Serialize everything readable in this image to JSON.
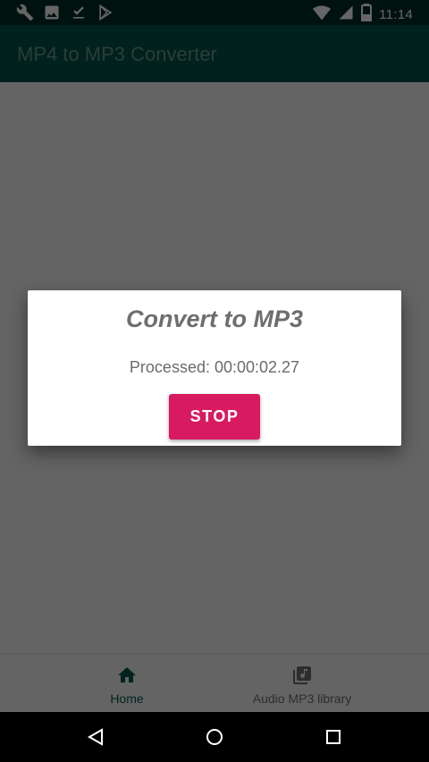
{
  "status_bar": {
    "time": "11:14",
    "left_icons": [
      "wrench-icon",
      "image-icon",
      "download-done-icon",
      "play-store-icon"
    ],
    "right_icons": [
      "wifi-icon",
      "signal-icon",
      "battery-icon"
    ]
  },
  "app_bar": {
    "title": "MP4 to MP3 Converter"
  },
  "dialog": {
    "title": "Convert to MP3",
    "message": "Processed: 00:00:02.27",
    "stop_label": "STOP",
    "accent_color": "#d81b60"
  },
  "bottom_nav": {
    "items": [
      {
        "label": "Home",
        "icon": "home-icon",
        "active": true
      },
      {
        "label": "Audio MP3 library",
        "icon": "music-library-icon",
        "active": false
      }
    ],
    "active_color": "#00574a"
  },
  "system_nav": {
    "buttons": [
      "back-icon",
      "home-circle-icon",
      "recents-icon"
    ]
  },
  "colors": {
    "primary": "#005446",
    "status_bar": "#002f26"
  }
}
